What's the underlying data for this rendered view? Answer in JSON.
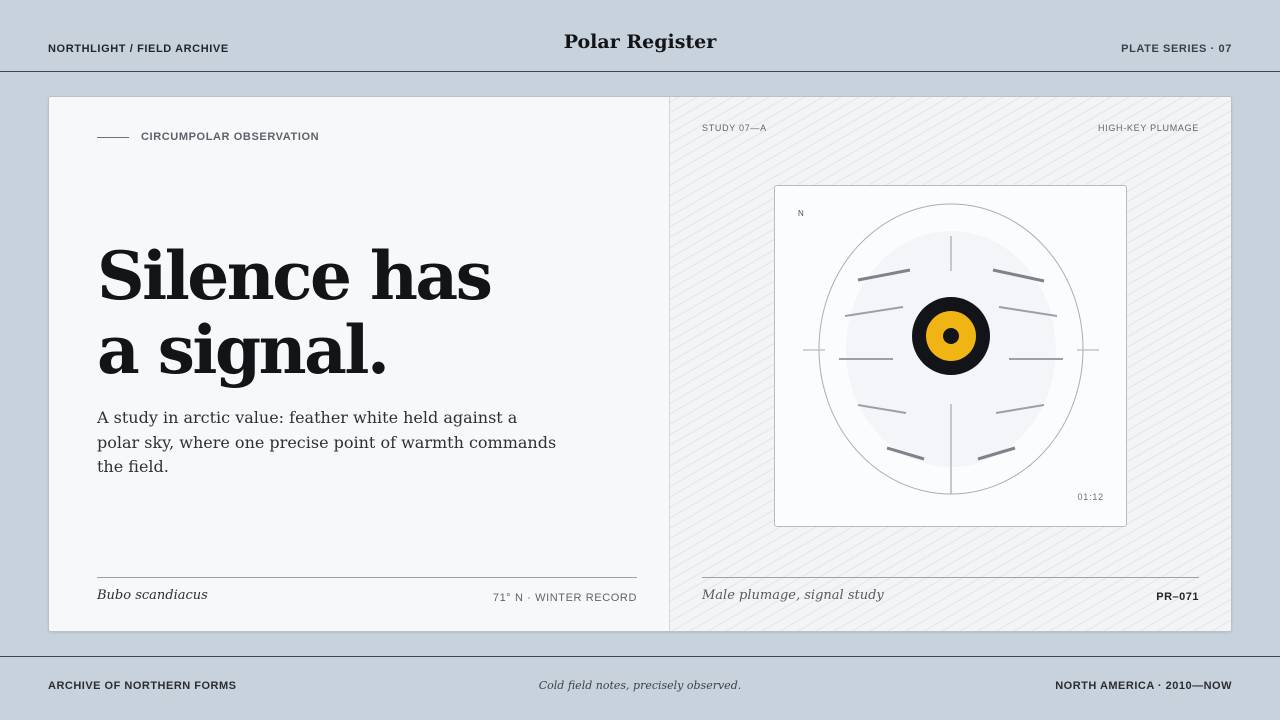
{
  "header": {
    "left_label": "NORTHLIGHT / FIELD ARCHIVE",
    "title": "Polar Register",
    "right_label": "PLATE SERIES · 07"
  },
  "intro": {
    "kicker": "CIRCUMPOLAR OBSERVATION",
    "headline_line1": "Silence has",
    "headline_line2": "a signal.",
    "lede": "A study in arctic value: feather white held against a polar sky, where one precise point of warmth commands the field.",
    "species": "Bubo scandiacus",
    "coordinates": "71° N · WINTER RECORD"
  },
  "plate": {
    "study_id": "STUDY 07—A",
    "study_tag": "HIGH-KEY PLUMAGE",
    "north_marker": "N",
    "timestamp": "01:12",
    "caption": "Male plumage, signal study",
    "code": "PR–071"
  },
  "footer": {
    "left_label": "ARCHIVE OF NORTHERN FORMS",
    "tagline": "Cold field notes, precisely observed.",
    "right_label": "NORTH AMERICA · 2010—NOW"
  },
  "colors": {
    "page_background": "#c8d2dc",
    "eye_iris": "#f0b414",
    "eye_ring": "#121417"
  }
}
